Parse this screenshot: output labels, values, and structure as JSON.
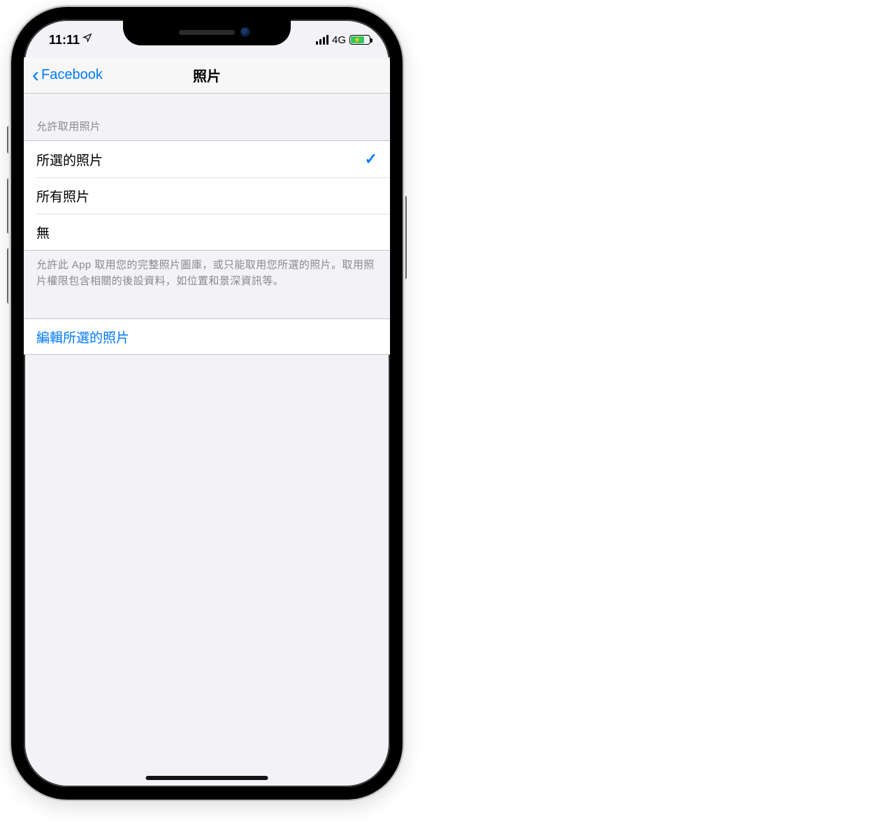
{
  "status": {
    "time": "11:11",
    "network": "4G"
  },
  "nav": {
    "back_label": "Facebook",
    "title": "照片"
  },
  "section": {
    "header": "允許取用照片",
    "footer": "允許此 App 取用您的完整照片圖庫，或只能取用您所選的照片。取用照片權限包含相關的後設資料，如位置和景深資訊等。",
    "options": [
      {
        "label": "所選的照片",
        "selected": true
      },
      {
        "label": "所有照片",
        "selected": false
      },
      {
        "label": "無",
        "selected": false
      }
    ]
  },
  "edit": {
    "label": "編輯所選的照片"
  }
}
